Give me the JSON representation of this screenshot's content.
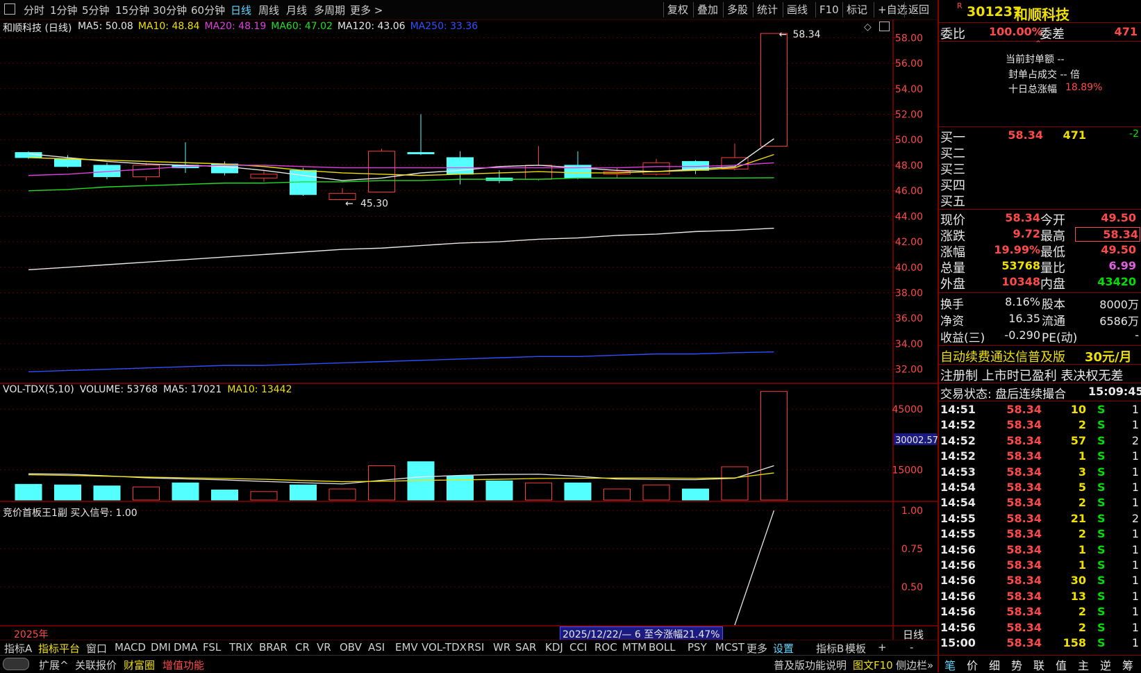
{
  "toolbar": {
    "left": [
      "分时",
      "1分钟",
      "5分钟",
      "15分钟",
      "30分钟",
      "60分钟",
      "日线",
      "周线",
      "月线",
      "多周期",
      "更多 >"
    ],
    "active": "日线",
    "right": [
      "复权",
      "叠加",
      "多股",
      "统计",
      "画线",
      "F10",
      "标记",
      "+自选",
      "返回"
    ]
  },
  "price_header": {
    "title": "和顺科技 (日线)",
    "ma": [
      {
        "label": "MA5: 50.08",
        "color": "#e8e8e8"
      },
      {
        "label": "MA10: 48.84",
        "color": "#f0e000"
      },
      {
        "label": "MA20: 48.19",
        "color": "#e040e0"
      },
      {
        "label": "MA60: 47.02",
        "color": "#20e020"
      },
      {
        "label": "MA120: 43.06",
        "color": "#e8e8e8"
      },
      {
        "label": "MA250: 33.36",
        "color": "#3050ff"
      }
    ]
  },
  "vol_header": [
    {
      "label": "VOL-TDX(5,10)",
      "color": "#e8e8e8"
    },
    {
      "label": "VOLUME: 53768",
      "color": "#e8e8e8"
    },
    {
      "label": "MA5: 17021",
      "color": "#e8e8e8"
    },
    {
      "label": "MA10: 13442",
      "color": "#f0e000"
    }
  ],
  "sig_header": "竞价首板王1副  买入信号: 1.00",
  "price_axis": [
    "58.00",
    "56.00",
    "54.00",
    "52.00",
    "50.00",
    "48.00",
    "46.00",
    "44.00",
    "42.00",
    "40.00",
    "38.00",
    "36.00",
    "34.00",
    "32.00"
  ],
  "vol_axis": [
    "45000",
    "15000"
  ],
  "vol_marker": "30002.57",
  "sig_axis": [
    "1.00",
    "0.75",
    "0.50"
  ],
  "annotations": {
    "high": "58.34",
    "low": "45.30"
  },
  "footer": {
    "year": "2025年",
    "range_text": "2025/12/22/— 6 至今涨幅21.47%",
    "right_label": "日线"
  },
  "chart_data": {
    "type": "candlestick",
    "price_range": [
      31,
      59
    ],
    "candles": [
      {
        "o": 49.0,
        "h": 49.1,
        "l": 48.5,
        "c": 48.6,
        "v": 7800
      },
      {
        "o": 48.5,
        "h": 48.8,
        "l": 47.8,
        "c": 47.9,
        "v": 7500
      },
      {
        "o": 48.0,
        "h": 48.2,
        "l": 46.9,
        "c": 47.1,
        "v": 7000
      },
      {
        "o": 47.1,
        "h": 48.2,
        "l": 46.8,
        "c": 48.0,
        "v": 6500
      },
      {
        "o": 48.0,
        "h": 49.8,
        "l": 47.4,
        "c": 47.8,
        "v": 8500
      },
      {
        "o": 48.1,
        "h": 48.3,
        "l": 47.2,
        "c": 47.4,
        "v": 5000
      },
      {
        "o": 47.0,
        "h": 47.6,
        "l": 46.7,
        "c": 47.3,
        "v": 4200
      },
      {
        "o": 47.6,
        "h": 47.8,
        "l": 45.6,
        "c": 45.7,
        "v": 7500
      },
      {
        "o": 45.3,
        "h": 46.2,
        "l": 45.3,
        "c": 45.8,
        "v": 5500
      },
      {
        "o": 45.9,
        "h": 49.3,
        "l": 45.9,
        "c": 49.1,
        "v": 17000
      },
      {
        "o": 49.0,
        "h": 52.0,
        "l": 48.8,
        "c": 48.9,
        "v": 19000
      },
      {
        "o": 48.6,
        "h": 49.1,
        "l": 46.5,
        "c": 47.3,
        "v": 12000
      },
      {
        "o": 47.0,
        "h": 47.6,
        "l": 46.6,
        "c": 46.8,
        "v": 9500
      },
      {
        "o": 46.9,
        "h": 49.5,
        "l": 46.8,
        "c": 48.0,
        "v": 8500
      },
      {
        "o": 48.0,
        "h": 49.1,
        "l": 46.9,
        "c": 47.0,
        "v": 8500
      },
      {
        "o": 47.3,
        "h": 47.8,
        "l": 47.0,
        "c": 47.5,
        "v": 5500
      },
      {
        "o": 47.3,
        "h": 48.5,
        "l": 47.2,
        "c": 48.2,
        "v": 7500
      },
      {
        "o": 48.3,
        "h": 48.4,
        "l": 47.3,
        "c": 47.6,
        "v": 5500
      },
      {
        "o": 47.7,
        "h": 49.7,
        "l": 47.6,
        "c": 48.6,
        "v": 16500
      },
      {
        "o": 49.5,
        "h": 58.34,
        "l": 49.5,
        "c": 58.34,
        "v": 53768
      }
    ],
    "ma_lines": [
      {
        "name": "MA5",
        "color": "#e8e8e8",
        "values": [
          48.9,
          48.6,
          48.3,
          48.1,
          48.0,
          47.9,
          47.6,
          47.2,
          46.8,
          47.0,
          47.4,
          47.6,
          47.9,
          48.0,
          47.8,
          47.6,
          47.5,
          47.7,
          47.9,
          50.08
        ]
      },
      {
        "name": "MA10",
        "color": "#f0e000",
        "values": [
          48.6,
          48.5,
          48.4,
          48.3,
          48.2,
          48.1,
          47.9,
          47.6,
          47.4,
          47.3,
          47.2,
          47.3,
          47.4,
          47.5,
          47.4,
          47.4,
          47.5,
          47.6,
          47.8,
          48.84
        ]
      },
      {
        "name": "MA20",
        "color": "#e040e0",
        "values": [
          47.2,
          47.3,
          47.5,
          47.7,
          47.9,
          48.0,
          48.0,
          47.9,
          47.8,
          47.8,
          47.8,
          47.8,
          47.8,
          47.8,
          47.8,
          47.8,
          47.9,
          47.9,
          48.0,
          48.19
        ]
      },
      {
        "name": "MA60",
        "color": "#20e020",
        "values": [
          46.0,
          46.1,
          46.3,
          46.4,
          46.5,
          46.6,
          46.6,
          46.7,
          46.7,
          46.8,
          46.8,
          46.9,
          46.9,
          46.9,
          47.0,
          47.0,
          47.0,
          47.0,
          47.0,
          47.02
        ]
      },
      {
        "name": "MA120",
        "color": "#e8e8e8",
        "values": [
          39.8,
          40.0,
          40.2,
          40.4,
          40.6,
          40.8,
          41.0,
          41.2,
          41.4,
          41.5,
          41.7,
          41.9,
          42.0,
          42.2,
          42.3,
          42.5,
          42.6,
          42.8,
          42.9,
          43.06
        ]
      },
      {
        "name": "MA250",
        "color": "#3050ff",
        "values": [
          31.8,
          31.9,
          32.0,
          32.1,
          32.2,
          32.3,
          32.3,
          32.4,
          32.5,
          32.6,
          32.7,
          32.8,
          32.9,
          33.0,
          33.0,
          33.1,
          33.2,
          33.2,
          33.3,
          33.36
        ]
      }
    ],
    "vol_ma5": [
      13000,
      12800,
      12000,
      11000,
      10500,
      10000,
      9200,
      8600,
      8000,
      9800,
      11500,
      12200,
      12700,
      12800,
      11800,
      10400,
      10200,
      10100,
      10800,
      17021
    ],
    "vol_ma10": [
      12500,
      12200,
      11800,
      11400,
      11000,
      10700,
      10300,
      9700,
      9100,
      9300,
      9700,
      10000,
      10300,
      10700,
      10800,
      10900,
      10900,
      10800,
      11000,
      13442
    ],
    "signal": [
      0,
      0,
      0,
      0,
      0,
      0,
      0,
      0,
      0,
      0,
      0,
      0,
      0,
      0,
      0,
      0,
      0,
      0,
      0,
      1.0
    ],
    "vol_range": [
      0,
      54000
    ],
    "signal_range": [
      0.25,
      1.05
    ]
  },
  "right_panel": {
    "code": "301237",
    "name": "和顺科技",
    "weibi_label": "委比",
    "weibi_val": "100.00%",
    "weicha_label": "委差",
    "weicha_val": "471",
    "seal_lines": [
      "当前封单额 --",
      "封单占成交 -- 倍",
      "十日总涨幅"
    ],
    "ten_day": "18.89%",
    "bids": [
      {
        "label": "买一",
        "price": "58.34",
        "vol": "471",
        "chg": "-2"
      },
      {
        "label": "买二",
        "price": "",
        "vol": "",
        "chg": ""
      },
      {
        "label": "买三",
        "price": "",
        "vol": "",
        "chg": ""
      },
      {
        "label": "买四",
        "price": "",
        "vol": "",
        "chg": ""
      },
      {
        "label": "买五",
        "price": "",
        "vol": "",
        "chg": ""
      }
    ],
    "quote": [
      {
        "l1": "现价",
        "v1": "58.34",
        "c1": "red",
        "l2": "今开",
        "v2": "49.50",
        "c2": "red"
      },
      {
        "l1": "涨跌",
        "v1": "9.72",
        "c1": "red",
        "l2": "最高",
        "v2": "58.34",
        "c2": "red"
      },
      {
        "l1": "涨幅",
        "v1": "19.99%",
        "c1": "red",
        "l2": "最低",
        "v2": "49.50",
        "c2": "red"
      },
      {
        "l1": "总量",
        "v1": "53768",
        "c1": "yellow",
        "l2": "量比",
        "v2": "6.99",
        "c2": "magenta"
      },
      {
        "l1": "外盘",
        "v1": "10348",
        "c1": "red",
        "l2": "内盘",
        "v2": "43420",
        "c2": "green"
      }
    ],
    "fund": [
      {
        "l1": "换手",
        "v1": "8.16%",
        "l2": "股本",
        "v2": "8000万"
      },
      {
        "l1": "净资",
        "v1": "16.35",
        "l2": "流通",
        "v2": "6586万"
      },
      {
        "l1": "收益(三)",
        "v1": "-0.290",
        "l2": "PE(动)",
        "v2": "-"
      }
    ],
    "ad_line1": "自动续费通达信普及版",
    "ad_price": "30元/月",
    "ad_line2": "注册制 上市时已盈利 表决权无差",
    "trade_status_label": "交易状态: 盘后连续撮合",
    "trade_status_time": "15:09:45",
    "ticks": [
      {
        "t": "14:51",
        "p": "58.34",
        "v": "10",
        "s": "S",
        "n": "1"
      },
      {
        "t": "14:52",
        "p": "58.34",
        "v": "2",
        "s": "S",
        "n": "1"
      },
      {
        "t": "14:52",
        "p": "58.34",
        "v": "57",
        "s": "S",
        "n": "2"
      },
      {
        "t": "14:52",
        "p": "58.34",
        "v": "1",
        "s": "S",
        "n": "1"
      },
      {
        "t": "14:53",
        "p": "58.34",
        "v": "3",
        "s": "S",
        "n": "1"
      },
      {
        "t": "14:54",
        "p": "58.34",
        "v": "5",
        "s": "S",
        "n": "1"
      },
      {
        "t": "14:54",
        "p": "58.34",
        "v": "2",
        "s": "S",
        "n": "1"
      },
      {
        "t": "14:55",
        "p": "58.34",
        "v": "21",
        "s": "S",
        "n": "2"
      },
      {
        "t": "14:55",
        "p": "58.34",
        "v": "2",
        "s": "S",
        "n": "1"
      },
      {
        "t": "14:56",
        "p": "58.34",
        "v": "1",
        "s": "S",
        "n": "1"
      },
      {
        "t": "14:56",
        "p": "58.34",
        "v": "1",
        "s": "S",
        "n": "1"
      },
      {
        "t": "14:56",
        "p": "58.34",
        "v": "30",
        "s": "S",
        "n": "1"
      },
      {
        "t": "14:56",
        "p": "58.34",
        "v": "13",
        "s": "S",
        "n": "1"
      },
      {
        "t": "14:56",
        "p": "58.34",
        "v": "2",
        "s": "S",
        "n": "1"
      },
      {
        "t": "14:56",
        "p": "58.34",
        "v": "2",
        "s": "S",
        "n": "1"
      },
      {
        "t": "15:00",
        "p": "58.34",
        "v": "158",
        "s": "S",
        "n": "1"
      }
    ],
    "bottom_tabs": [
      "笔",
      "价",
      "细",
      "势",
      "联",
      "值",
      "主",
      "逆",
      "筹"
    ]
  },
  "tabs": [
    "指标A",
    "指标平台",
    "窗口",
    "MACD",
    "DMI",
    "DMA",
    "FSL",
    "TRIX",
    "BRAR",
    "CR",
    "VR",
    "OBV",
    "ASI",
    "EMV",
    "VOL-TDX",
    "RSI",
    "WR",
    "SAR",
    "KDJ",
    "CCI",
    "ROC",
    "MTM",
    "BOLL",
    "PSY",
    "MCST",
    "更多",
    "设置",
    "指标B",
    "模板",
    "+",
    "-"
  ],
  "status": {
    "items": [
      {
        "text": "扩展^",
        "color": "#d0d0d0"
      },
      {
        "text": "关联报价",
        "color": "#d0d0d0"
      },
      {
        "text": "财富圈",
        "color": "#f0e000"
      },
      {
        "text": "增值功能",
        "color": "#ff4a4a"
      }
    ],
    "right_items": [
      {
        "text": "普及版功能说明",
        "color": "#d0d0d0"
      },
      {
        "text": "图文F10",
        "color": "#f0e000"
      },
      {
        "text": "侧边栏»",
        "color": "#d0d0d0"
      }
    ]
  }
}
